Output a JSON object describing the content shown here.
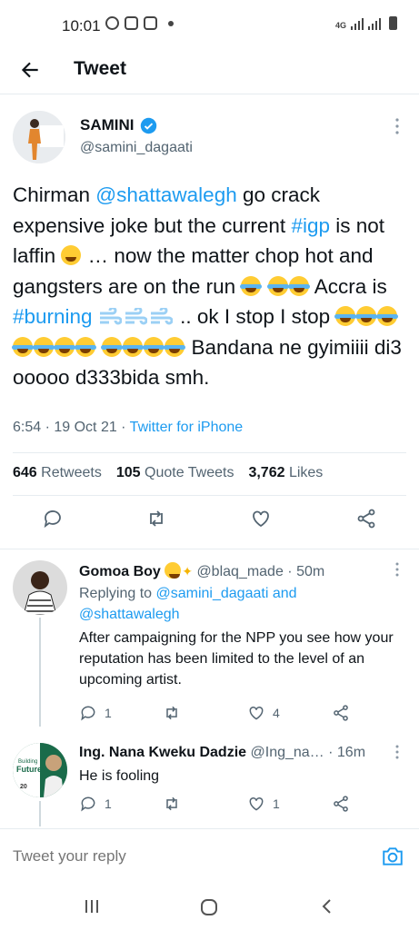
{
  "status_bar": {
    "time": "10:01",
    "network": "4G"
  },
  "header": {
    "title": "Tweet"
  },
  "tweet": {
    "author_name": "SAMINI",
    "author_handle": "@samini_dagaati",
    "text": {
      "p1": "Chirman ",
      "mention1": "@shattawalegh",
      "p2": " go crack expensive joke but the current ",
      "tag_igp": "#igp",
      "p3": " is not laffin ",
      "p4": " … now the matter chop hot and gangsters are on the run ",
      "p5": " Accra is ",
      "tag_burning": "#burning",
      "p6": " .. ok I stop I stop ",
      "p7": " Bandana ne gyimiiii di3 ooooo d333bida smh."
    },
    "time": "6:54",
    "date": "19 Oct 21",
    "source": "Twitter for iPhone",
    "stats": {
      "retweets_count": "646",
      "retweets_label": "Retweets",
      "quotes_count": "105",
      "quotes_label": "Quote Tweets",
      "likes_count": "3,762",
      "likes_label": "Likes"
    }
  },
  "replies": [
    {
      "name": "Gomoa Boy",
      "handle": "@blaq_made",
      "time": "50m",
      "replying_label": "Replying to",
      "replying_to_1": "@samini_dagaati",
      "replying_and": "and",
      "replying_to_2": "@shattawalegh",
      "text": "After campaigning for the NPP you see how your reputation has been limited to the level of an upcoming artist.",
      "reply_count": "1",
      "retweet_count": "",
      "like_count": "4"
    },
    {
      "name": "Ing. Nana Kweku Dadzie",
      "handle": "@Ing_na…",
      "time": "16m",
      "text": "He is fooling",
      "reply_count": "1",
      "retweet_count": "",
      "like_count": "1",
      "avatar_text": "Building Future",
      "avatar_number": "20"
    }
  ],
  "compose": {
    "placeholder": "Tweet your reply"
  },
  "colors": {
    "accent": "#1d9bf0",
    "text": "#0f1419",
    "muted": "#536471",
    "divider": "#e6ecf0"
  }
}
